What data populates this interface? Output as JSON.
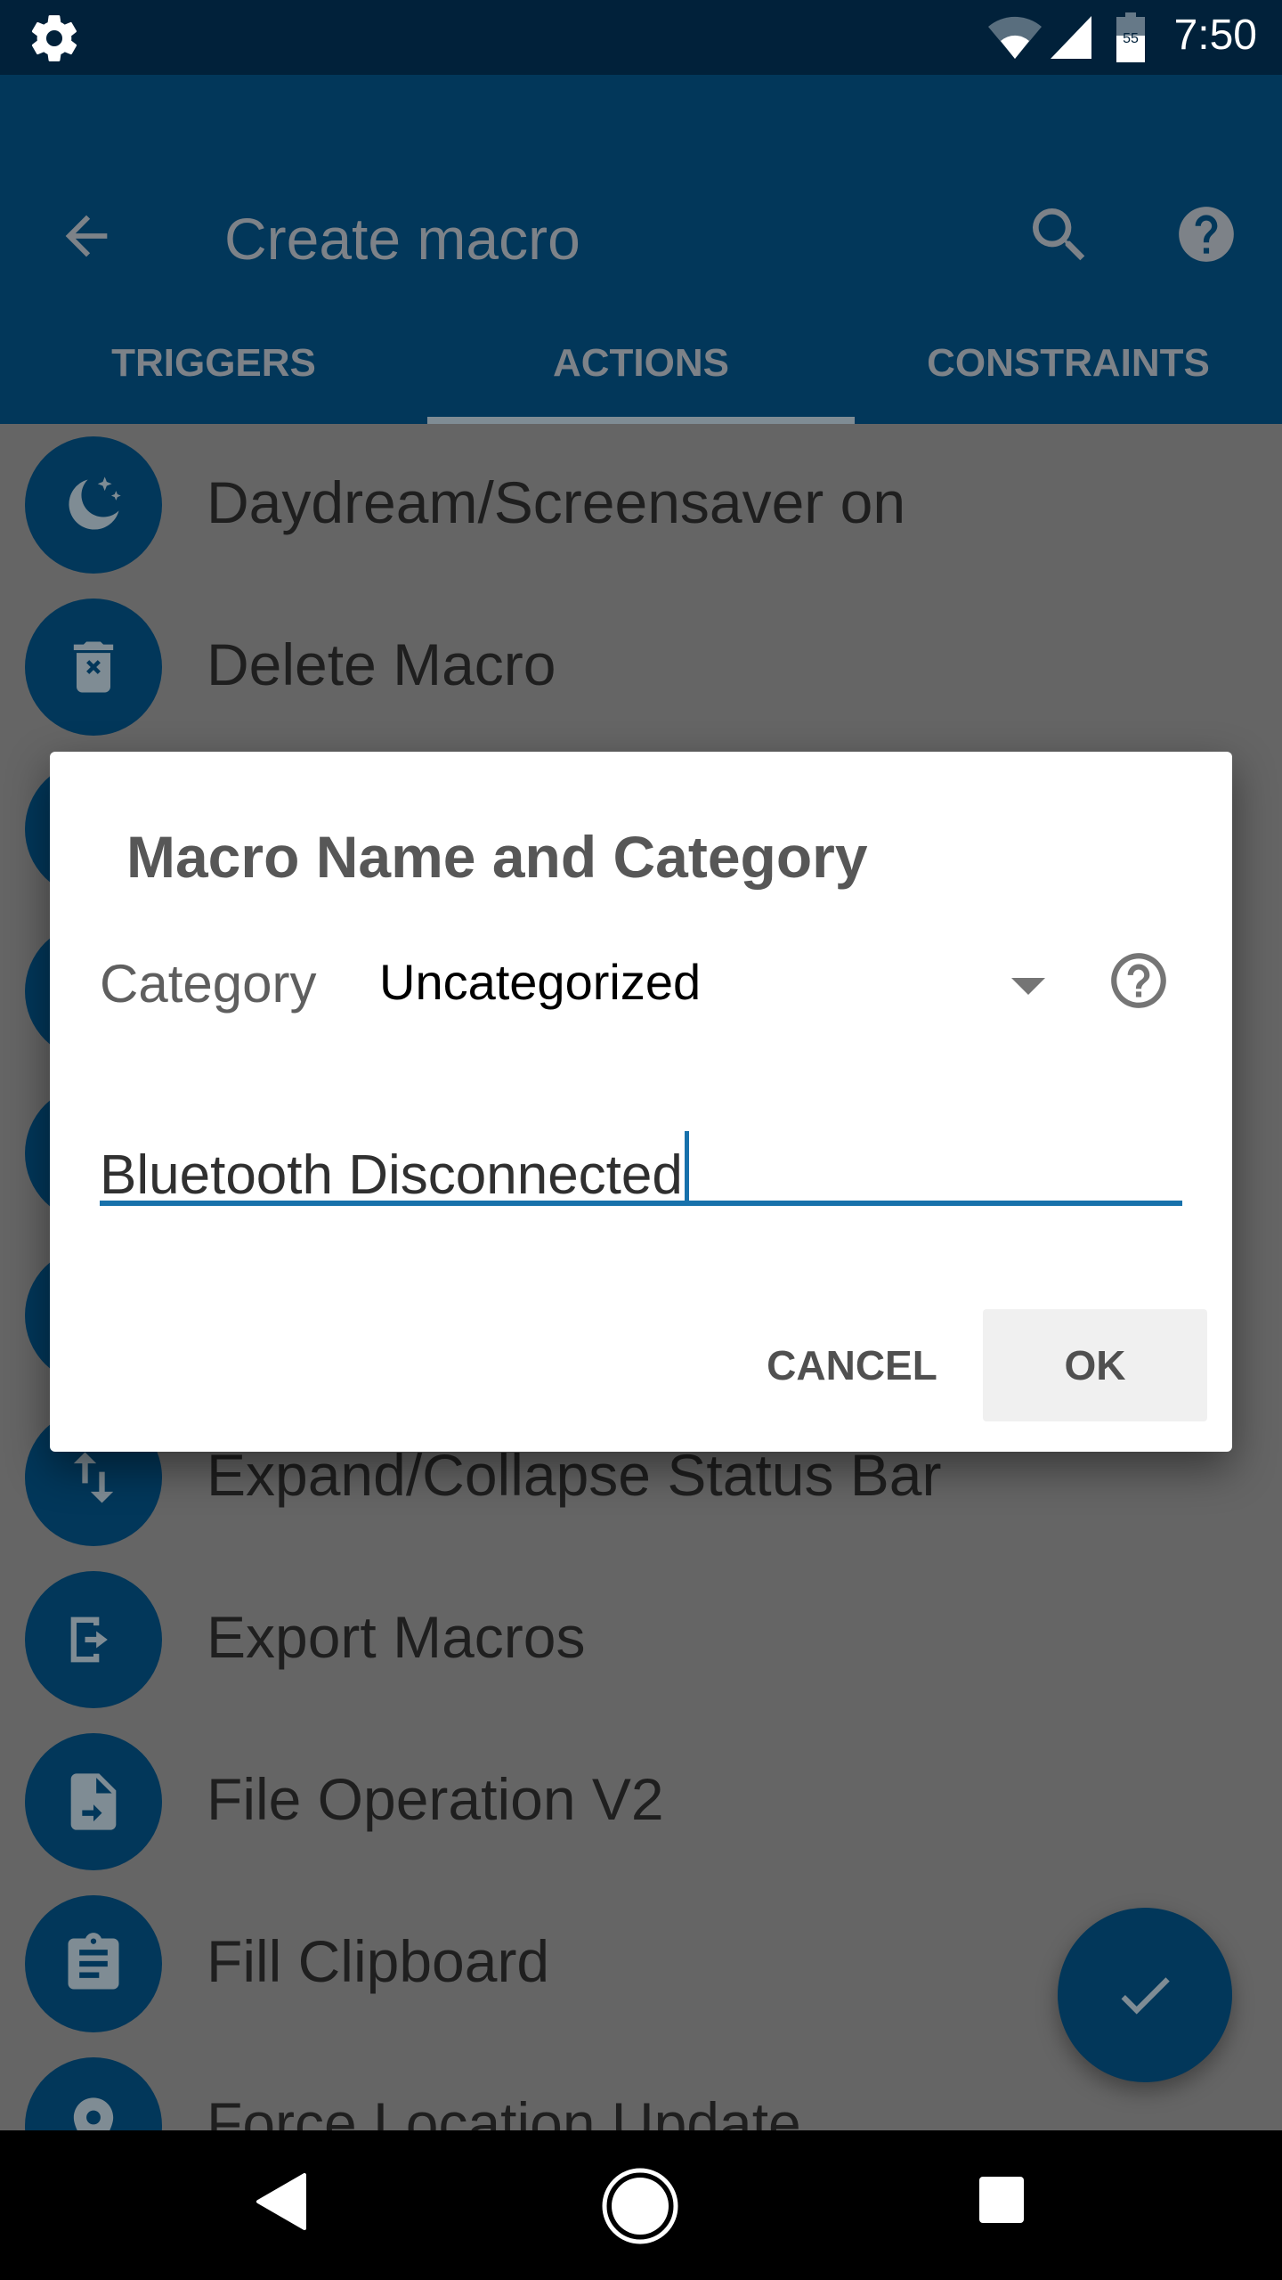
{
  "status_bar": {
    "time": "7:50",
    "battery_level": "55",
    "icons": [
      "gear-icon",
      "wifi-icon",
      "cell-signal-icon",
      "battery-icon"
    ]
  },
  "app_bar": {
    "title": "Create macro",
    "icons": [
      "back-arrow-icon",
      "search-icon",
      "help-icon"
    ]
  },
  "tabs": [
    {
      "label": "TRIGGERS",
      "active": false
    },
    {
      "label": "ACTIONS",
      "active": true
    },
    {
      "label": "CONSTRAINTS",
      "active": false
    }
  ],
  "actions_list": [
    {
      "label": "Daydream/Screensaver on",
      "icon": "moon-stars-icon"
    },
    {
      "label": "Delete Macro",
      "icon": "trash-icon"
    },
    {
      "label": "",
      "icon": ""
    },
    {
      "label": "",
      "icon": ""
    },
    {
      "label": "",
      "icon": ""
    },
    {
      "label": "",
      "icon": ""
    },
    {
      "label": "Expand/Collapse Status Bar",
      "icon": "expand-collapse-icon"
    },
    {
      "label": "Export Macros",
      "icon": "export-icon"
    },
    {
      "label": "File Operation V2",
      "icon": "file-operation-icon"
    },
    {
      "label": "Fill Clipboard",
      "icon": "clipboard-icon"
    },
    {
      "label": "Force Location Update",
      "icon": "location-pin-icon"
    }
  ],
  "fab": {
    "icon": "checkmark-icon"
  },
  "dialog": {
    "title": "Macro Name and Category",
    "category_label": "Category",
    "category_value": "Uncategorized",
    "name_value": "Bluetooth Disconnected",
    "cancel_label": "CANCEL",
    "ok_label": "OK"
  },
  "colors": {
    "primary": "#02375a",
    "status_bar": "#01213a",
    "accent": "#1771ab",
    "scrim_list_bg": "#656565"
  }
}
